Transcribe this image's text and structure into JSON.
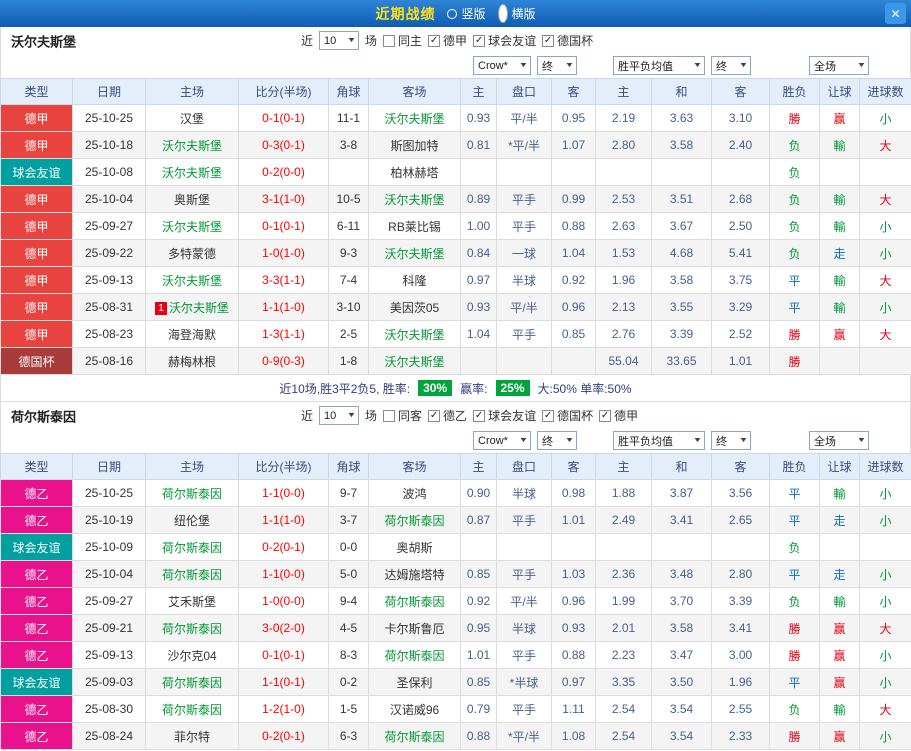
{
  "titlebar": {
    "title": "近期战绩",
    "options": [
      {
        "label": "竖版",
        "selected": false
      },
      {
        "label": "横版",
        "selected": true
      }
    ],
    "close": "✕"
  },
  "colors": {
    "league": {
      "德甲": "#e8433f",
      "德乙": "#e9128c",
      "德国杯": "#a93b3b",
      "球会友谊": "#00a0a0"
    },
    "team_green": "#009933",
    "score_red": "#ff0000",
    "result_red": "#e60012",
    "result_green": "#009933",
    "result_blue": "#0a6ebd",
    "badge_green": "#00a33c",
    "title_yellow": "#ffe11a",
    "titlebar_blue": "#1268c3"
  },
  "sections": [
    {
      "team": "沃尔夫斯堡",
      "near_label": "近",
      "count": "10",
      "games_label": "场",
      "filters": [
        {
          "label": "同主",
          "checked": false
        },
        {
          "label": "德甲",
          "checked": true
        },
        {
          "label": "球会友谊",
          "checked": true
        },
        {
          "label": "德国杯",
          "checked": true
        }
      ],
      "selects": [
        {
          "key": "bookmaker",
          "label": "Crow*"
        },
        {
          "key": "bktime",
          "label": "终"
        },
        {
          "key": "avg",
          "label": "胜平负均值"
        },
        {
          "key": "avgtime",
          "label": "终"
        },
        {
          "key": "scope",
          "label": "全场"
        }
      ],
      "headers": [
        "类型",
        "日期",
        "主场",
        "比分(半场)",
        "角球",
        "客场",
        "主",
        "盘口",
        "客",
        "主",
        "和",
        "客",
        "胜负",
        "让球",
        "进球数"
      ],
      "rows": [
        {
          "league": "德甲",
          "date": "25-10-25",
          "home": "汉堡",
          "home_team": false,
          "badge": "",
          "score": "0-1(0-1)",
          "corners": "11-1",
          "away": "沃尔夫斯堡",
          "away_team": true,
          "odds_home": "0.93",
          "handicap": "平/半",
          "odds_away": "0.95",
          "avg_home": "2.19",
          "avg_draw": "3.63",
          "avg_away": "3.10",
          "result": "勝",
          "result_c": "red",
          "handicap_result": "赢",
          "handicap_result_c": "red",
          "goals": "小",
          "goals_c": "green"
        },
        {
          "league": "德甲",
          "date": "25-10-18",
          "home": "沃尔夫斯堡",
          "home_team": true,
          "badge": "",
          "score": "0-3(0-1)",
          "corners": "3-8",
          "away": "斯图加特",
          "away_team": false,
          "odds_home": "0.81",
          "handicap": "*平/半",
          "odds_away": "1.07",
          "avg_home": "2.80",
          "avg_draw": "3.58",
          "avg_away": "2.40",
          "result": "负",
          "result_c": "green",
          "handicap_result": "輸",
          "handicap_result_c": "green",
          "goals": "大",
          "goals_c": "red"
        },
        {
          "league": "球会友谊",
          "date": "25-10-08",
          "home": "沃尔夫斯堡",
          "home_team": true,
          "badge": "",
          "score": "0-2(0-0)",
          "corners": "",
          "away": "柏林赫塔",
          "away_team": false,
          "odds_home": "",
          "handicap": "",
          "odds_away": "",
          "avg_home": "",
          "avg_draw": "",
          "avg_away": "",
          "result": "负",
          "result_c": "green",
          "handicap_result": "",
          "handicap_result_c": "none",
          "goals": "",
          "goals_c": "none"
        },
        {
          "league": "德甲",
          "date": "25-10-04",
          "home": "奥斯堡",
          "home_team": false,
          "badge": "",
          "score": "3-1(1-0)",
          "corners": "10-5",
          "away": "沃尔夫斯堡",
          "away_team": true,
          "odds_home": "0.89",
          "handicap": "平手",
          "odds_away": "0.99",
          "avg_home": "2.53",
          "avg_draw": "3.51",
          "avg_away": "2.68",
          "result": "负",
          "result_c": "green",
          "handicap_result": "輸",
          "handicap_result_c": "green",
          "goals": "大",
          "goals_c": "red"
        },
        {
          "league": "德甲",
          "date": "25-09-27",
          "home": "沃尔夫斯堡",
          "home_team": true,
          "badge": "",
          "score": "0-1(0-1)",
          "corners": "6-11",
          "away": "RB莱比锡",
          "away_team": false,
          "odds_home": "1.00",
          "handicap": "平手",
          "odds_away": "0.88",
          "avg_home": "2.63",
          "avg_draw": "3.67",
          "avg_away": "2.50",
          "result": "负",
          "result_c": "green",
          "handicap_result": "輸",
          "handicap_result_c": "green",
          "goals": "小",
          "goals_c": "green"
        },
        {
          "league": "德甲",
          "date": "25-09-22",
          "home": "多特蒙德",
          "home_team": false,
          "badge": "",
          "score": "1-0(1-0)",
          "corners": "9-3",
          "away": "沃尔夫斯堡",
          "away_team": true,
          "odds_home": "0.84",
          "handicap": "一球",
          "odds_away": "1.04",
          "avg_home": "1.53",
          "avg_draw": "4.68",
          "avg_away": "5.41",
          "result": "负",
          "result_c": "green",
          "handicap_result": "走",
          "handicap_result_c": "blue",
          "goals": "小",
          "goals_c": "green"
        },
        {
          "league": "德甲",
          "date": "25-09-13",
          "home": "沃尔夫斯堡",
          "home_team": true,
          "badge": "",
          "score": "3-3(1-1)",
          "corners": "7-4",
          "away": "科隆",
          "away_team": false,
          "odds_home": "0.97",
          "handicap": "半球",
          "odds_away": "0.92",
          "avg_home": "1.96",
          "avg_draw": "3.58",
          "avg_away": "3.75",
          "result": "平",
          "result_c": "blue",
          "handicap_result": "輸",
          "handicap_result_c": "green",
          "goals": "大",
          "goals_c": "red"
        },
        {
          "league": "德甲",
          "date": "25-08-31",
          "home": "沃尔夫斯堡",
          "home_team": true,
          "badge": "1",
          "score": "1-1(1-0)",
          "corners": "3-10",
          "away": "美因茨05",
          "away_team": false,
          "odds_home": "0.93",
          "handicap": "平/半",
          "odds_away": "0.96",
          "avg_home": "2.13",
          "avg_draw": "3.55",
          "avg_away": "3.29",
          "result": "平",
          "result_c": "blue",
          "handicap_result": "輸",
          "handicap_result_c": "green",
          "goals": "小",
          "goals_c": "green"
        },
        {
          "league": "德甲",
          "date": "25-08-23",
          "home": "海登海默",
          "home_team": false,
          "badge": "",
          "score": "1-3(1-1)",
          "corners": "2-5",
          "away": "沃尔夫斯堡",
          "away_team": true,
          "odds_home": "1.04",
          "handicap": "平手",
          "odds_away": "0.85",
          "avg_home": "2.76",
          "avg_draw": "3.39",
          "avg_away": "2.52",
          "result": "勝",
          "result_c": "red",
          "handicap_result": "赢",
          "handicap_result_c": "red",
          "goals": "大",
          "goals_c": "red"
        },
        {
          "league": "德国杯",
          "date": "25-08-16",
          "home": "赫梅林根",
          "home_team": false,
          "badge": "",
          "score": "0-9(0-3)",
          "corners": "1-8",
          "away": "沃尔夫斯堡",
          "away_team": true,
          "odds_home": "",
          "handicap": "",
          "odds_away": "",
          "avg_home": "55.04",
          "avg_draw": "33.65",
          "avg_away": "1.01",
          "result": "勝",
          "result_c": "red",
          "handicap_result": "",
          "handicap_result_c": "none",
          "goals": "",
          "goals_c": "none"
        }
      ],
      "summary": {
        "prefix": "近10场,胜3平2负5, 胜率:",
        "win_rate": "30%",
        "mid": "赢率:",
        "handicap_rate": "25%",
        "tail": "大:50% 单率:50%"
      }
    },
    {
      "team": "荷尔斯泰因",
      "near_label": "近",
      "count": "10",
      "games_label": "场",
      "filters": [
        {
          "label": "同客",
          "checked": false
        },
        {
          "label": "德乙",
          "checked": true
        },
        {
          "label": "球会友谊",
          "checked": true
        },
        {
          "label": "德国杯",
          "checked": true
        },
        {
          "label": "德甲",
          "checked": true
        }
      ],
      "selects": [
        {
          "key": "bookmaker",
          "label": "Crow*"
        },
        {
          "key": "bktime",
          "label": "终"
        },
        {
          "key": "avg",
          "label": "胜平负均值"
        },
        {
          "key": "avgtime",
          "label": "终"
        },
        {
          "key": "scope",
          "label": "全场"
        }
      ],
      "headers": [
        "类型",
        "日期",
        "主场",
        "比分(半场)",
        "角球",
        "客场",
        "主",
        "盘口",
        "客",
        "主",
        "和",
        "客",
        "胜负",
        "让球",
        "进球数"
      ],
      "rows": [
        {
          "league": "德乙",
          "date": "25-10-25",
          "home": "荷尔斯泰因",
          "home_team": true,
          "badge": "",
          "score": "1-1(0-0)",
          "corners": "9-7",
          "away": "波鸿",
          "away_team": false,
          "odds_home": "0.90",
          "handicap": "半球",
          "odds_away": "0.98",
          "avg_home": "1.88",
          "avg_draw": "3.87",
          "avg_away": "3.56",
          "result": "平",
          "result_c": "blue",
          "handicap_result": "輸",
          "handicap_result_c": "green",
          "goals": "小",
          "goals_c": "green"
        },
        {
          "league": "德乙",
          "date": "25-10-19",
          "home": "纽伦堡",
          "home_team": false,
          "badge": "",
          "score": "1-1(1-0)",
          "corners": "3-7",
          "away": "荷尔斯泰因",
          "away_team": true,
          "odds_home": "0.87",
          "handicap": "平手",
          "odds_away": "1.01",
          "avg_home": "2.49",
          "avg_draw": "3.41",
          "avg_away": "2.65",
          "result": "平",
          "result_c": "blue",
          "handicap_result": "走",
          "handicap_result_c": "blue",
          "goals": "小",
          "goals_c": "green"
        },
        {
          "league": "球会友谊",
          "date": "25-10-09",
          "home": "荷尔斯泰因",
          "home_team": true,
          "badge": "",
          "score": "0-2(0-1)",
          "corners": "0-0",
          "away": "奥胡斯",
          "away_team": false,
          "odds_home": "",
          "handicap": "",
          "odds_away": "",
          "avg_home": "",
          "avg_draw": "",
          "avg_away": "",
          "result": "负",
          "result_c": "green",
          "handicap_result": "",
          "handicap_result_c": "none",
          "goals": "",
          "goals_c": "none"
        },
        {
          "league": "德乙",
          "date": "25-10-04",
          "home": "荷尔斯泰因",
          "home_team": true,
          "badge": "",
          "score": "1-1(0-0)",
          "corners": "5-0",
          "away": "达姆施塔特",
          "away_team": false,
          "odds_home": "0.85",
          "handicap": "平手",
          "odds_away": "1.03",
          "avg_home": "2.36",
          "avg_draw": "3.48",
          "avg_away": "2.80",
          "result": "平",
          "result_c": "blue",
          "handicap_result": "走",
          "handicap_result_c": "blue",
          "goals": "小",
          "goals_c": "green"
        },
        {
          "league": "德乙",
          "date": "25-09-27",
          "home": "艾禾斯堡",
          "home_team": false,
          "badge": "",
          "score": "1-0(0-0)",
          "corners": "9-4",
          "away": "荷尔斯泰因",
          "away_team": true,
          "odds_home": "0.92",
          "handicap": "平/半",
          "odds_away": "0.96",
          "avg_home": "1.99",
          "avg_draw": "3.70",
          "avg_away": "3.39",
          "result": "负",
          "result_c": "green",
          "handicap_result": "輸",
          "handicap_result_c": "green",
          "goals": "小",
          "goals_c": "green"
        },
        {
          "league": "德乙",
          "date": "25-09-21",
          "home": "荷尔斯泰因",
          "home_team": true,
          "badge": "",
          "score": "3-0(2-0)",
          "corners": "4-5",
          "away": "卡尔斯鲁厄",
          "away_team": false,
          "odds_home": "0.95",
          "handicap": "半球",
          "odds_away": "0.93",
          "avg_home": "2.01",
          "avg_draw": "3.58",
          "avg_away": "3.41",
          "result": "勝",
          "result_c": "red",
          "handicap_result": "赢",
          "handicap_result_c": "red",
          "goals": "大",
          "goals_c": "red"
        },
        {
          "league": "德乙",
          "date": "25-09-13",
          "home": "沙尔克04",
          "home_team": false,
          "badge": "",
          "score": "0-1(0-1)",
          "corners": "8-3",
          "away": "荷尔斯泰因",
          "away_team": true,
          "odds_home": "1.01",
          "handicap": "平手",
          "odds_away": "0.88",
          "avg_home": "2.23",
          "avg_draw": "3.47",
          "avg_away": "3.00",
          "result": "勝",
          "result_c": "red",
          "handicap_result": "赢",
          "handicap_result_c": "red",
          "goals": "小",
          "goals_c": "green"
        },
        {
          "league": "球会友谊",
          "date": "25-09-03",
          "home": "荷尔斯泰因",
          "home_team": true,
          "badge": "",
          "score": "1-1(0-1)",
          "corners": "0-2",
          "away": "圣保利",
          "away_team": false,
          "odds_home": "0.85",
          "handicap": "*半球",
          "odds_away": "0.97",
          "avg_home": "3.35",
          "avg_draw": "3.50",
          "avg_away": "1.96",
          "result": "平",
          "result_c": "blue",
          "handicap_result": "赢",
          "handicap_result_c": "red",
          "goals": "小",
          "goals_c": "green"
        },
        {
          "league": "德乙",
          "date": "25-08-30",
          "home": "荷尔斯泰因",
          "home_team": true,
          "badge": "",
          "score": "1-2(1-0)",
          "corners": "1-5",
          "away": "汉诺威96",
          "away_team": false,
          "odds_home": "0.79",
          "handicap": "平手",
          "odds_away": "1.11",
          "avg_home": "2.54",
          "avg_draw": "3.54",
          "avg_away": "2.55",
          "result": "负",
          "result_c": "green",
          "handicap_result": "輸",
          "handicap_result_c": "green",
          "goals": "大",
          "goals_c": "red"
        },
        {
          "league": "德乙",
          "date": "25-08-24",
          "home": "菲尔特",
          "home_team": false,
          "badge": "",
          "score": "0-2(0-1)",
          "corners": "6-3",
          "away": "荷尔斯泰因",
          "away_team": true,
          "odds_home": "0.88",
          "handicap": "*平/半",
          "odds_away": "1.08",
          "avg_home": "2.54",
          "avg_draw": "3.54",
          "avg_away": "2.33",
          "result": "勝",
          "result_c": "red",
          "handicap_result": "赢",
          "handicap_result_c": "red",
          "goals": "小",
          "goals_c": "green"
        }
      ]
    }
  ]
}
